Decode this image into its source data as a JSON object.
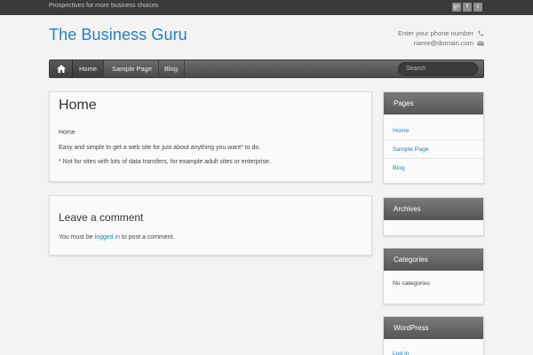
{
  "topbar": {
    "tagline": "Prospectives for more business choices",
    "social": [
      {
        "icon": "google-plus-icon",
        "glyph": "g+"
      },
      {
        "icon": "facebook-icon",
        "glyph": "f"
      },
      {
        "icon": "twitter-icon",
        "glyph": "t"
      }
    ]
  },
  "header": {
    "site_title": "The Business Guru",
    "phone": "Enter your phone number",
    "email": "name@domain.com"
  },
  "nav": {
    "items": [
      "Home",
      "Sample Page",
      "Blog"
    ],
    "search_placeholder": "Search"
  },
  "post": {
    "title": "Home",
    "lines": [
      "Home",
      "Easy and simple to get a web site for just about anything you want* to do.",
      "* Not for sites with lots of data transfers, for example adult sites or enterprise."
    ]
  },
  "comment": {
    "title": "Leave a comment",
    "prefix": "You must be",
    "link": "logged in",
    "suffix": "to post a comment."
  },
  "sidebar": {
    "pages": {
      "title": "Pages",
      "items": [
        "Home",
        "Sample Page",
        "Blog"
      ]
    },
    "archives": {
      "title": "Archives"
    },
    "categories": {
      "title": "Categories",
      "text": "No categories"
    },
    "wordpress": {
      "title": "WordPress",
      "items": [
        "Log in"
      ]
    }
  },
  "colors": {
    "accent": "#1e82c6",
    "nav": "#555555",
    "background": "#f3f3f3"
  }
}
